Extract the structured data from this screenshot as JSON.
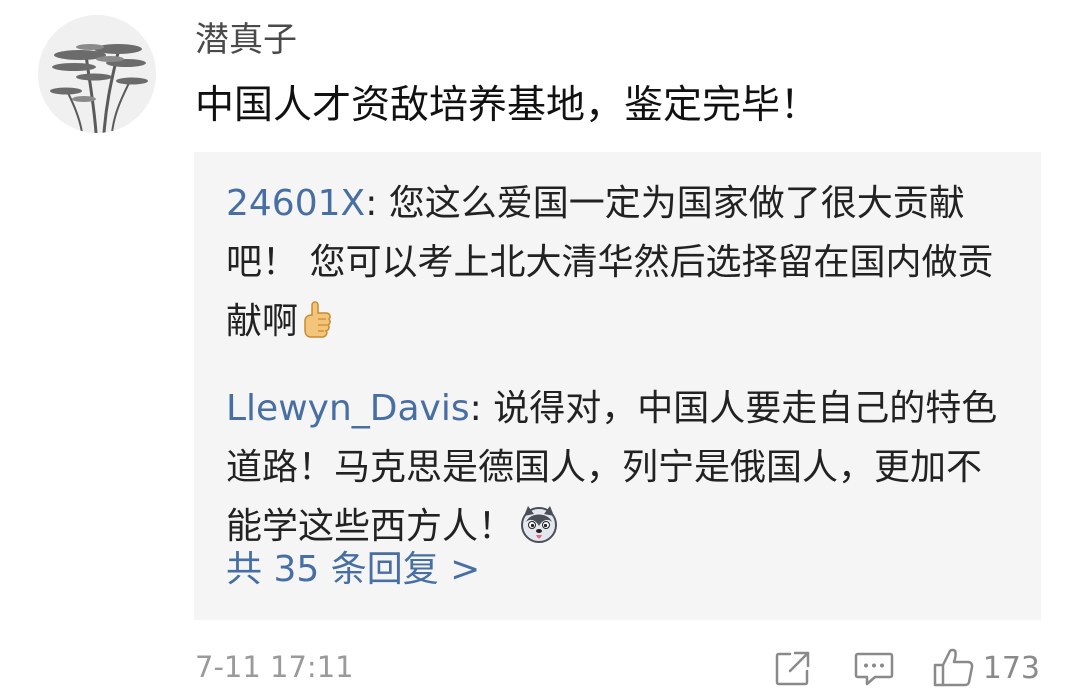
{
  "comment": {
    "username": "潜真子",
    "text": "中国人才资敌培养基地，鉴定完毕！",
    "timestamp": "7-11 17:11",
    "like_count": "173",
    "avatar_icon": "ink-tree-painting-avatar"
  },
  "replies": [
    {
      "author": "24601X",
      "separator": ": ",
      "text": "您这么爱国一定为国家做了很大贡献吧！ 您可以考上北大清华然后选择留在国内做贡献啊",
      "emoji": "thumbs-up-emoji"
    },
    {
      "author": "Llewyn_Davis",
      "separator": ": ",
      "text": "说得对，中国人要走自己的特色道路！马克思是德国人，列宁是俄国人，更加不能学这些西方人！",
      "emoji": "husky-dog-emoji"
    }
  ],
  "more_replies_label": "共 35 条回复 >",
  "icons": {
    "share": "share-icon",
    "reply": "comment-icon",
    "like": "thumbs-up-icon"
  },
  "colors": {
    "link": "#476fa3",
    "reply_background": "#f5f5f5",
    "meta": "#9a9a9a"
  }
}
